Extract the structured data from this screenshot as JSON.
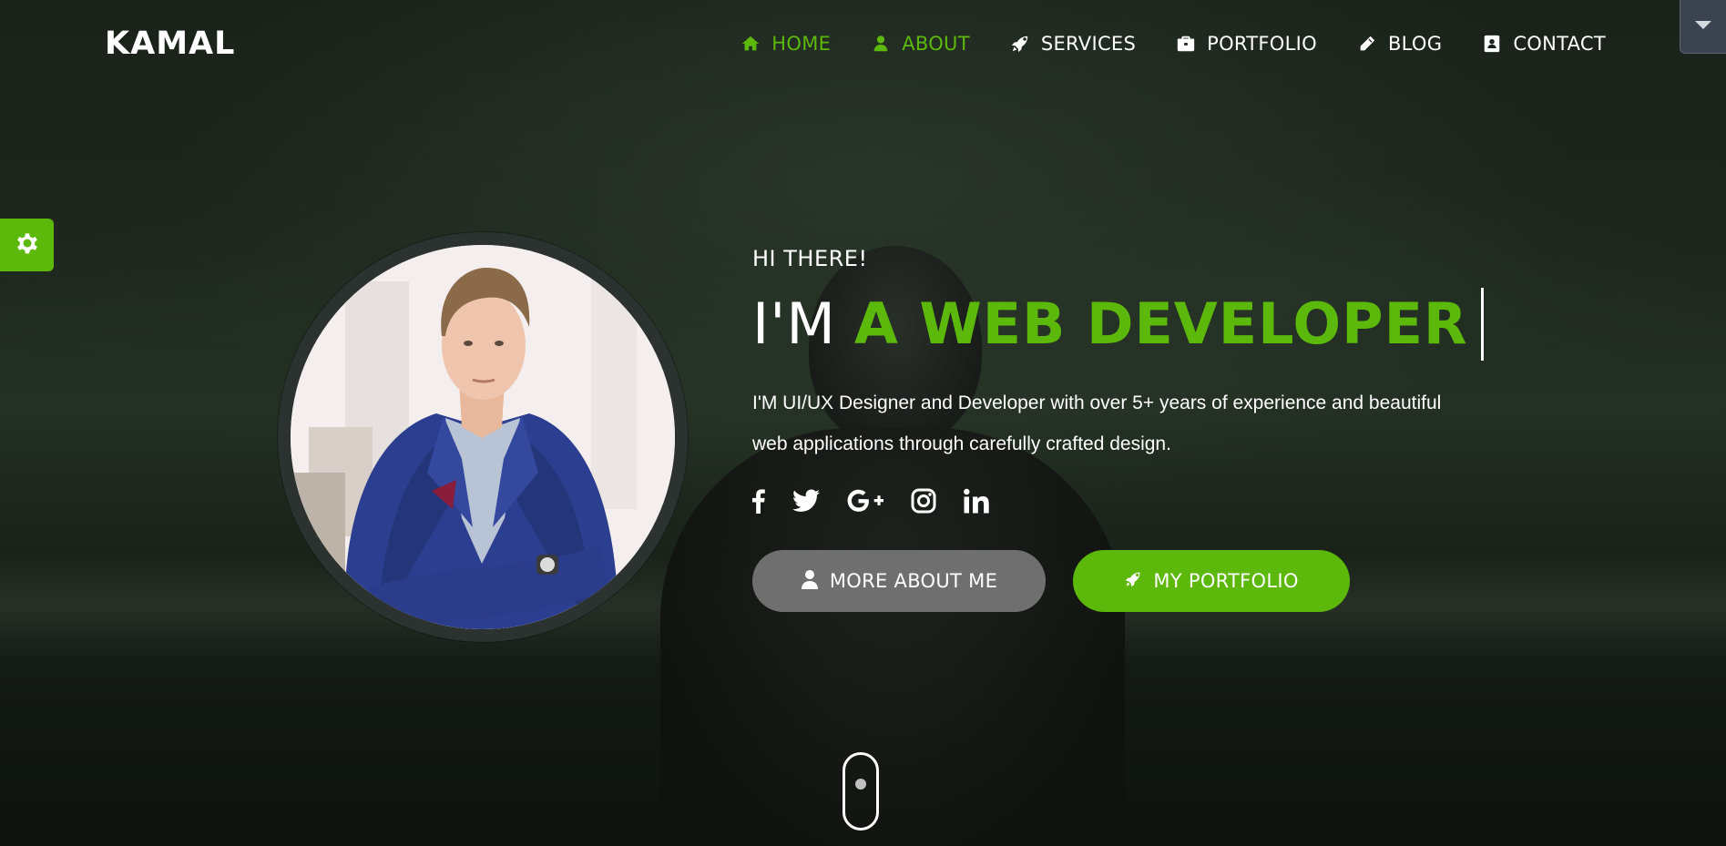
{
  "brand": "KAMAL",
  "nav": {
    "items": [
      {
        "label": "HOME",
        "icon": "home-icon",
        "active": true
      },
      {
        "label": "ABOUT",
        "icon": "user-icon",
        "active": true
      },
      {
        "label": "SERVICES",
        "icon": "rocket-icon",
        "active": false
      },
      {
        "label": "PORTFOLIO",
        "icon": "briefcase-icon",
        "active": false
      },
      {
        "label": "BLOG",
        "icon": "pencil-icon",
        "active": false
      },
      {
        "label": "CONTACT",
        "icon": "address-book-icon",
        "active": false
      }
    ]
  },
  "hero": {
    "greeting": "HI THERE!",
    "headline_prefix": "I'M",
    "headline_typed": "A WEB DEVELOPER",
    "description": "I'M UI/UX Designer and Developer with over 5+ years of experience and beautiful web applications through carefully crafted design.",
    "social": [
      "facebook-icon",
      "twitter-icon",
      "google-plus-icon",
      "instagram-icon",
      "linkedin-icon"
    ],
    "buttons": {
      "more_about": "MORE ABOUT ME",
      "portfolio": "MY PORTFOLIO"
    }
  },
  "colors": {
    "accent": "#5cb80a",
    "button_secondary": "#6f6f6f",
    "dropdown_tab": "#3b4250"
  }
}
